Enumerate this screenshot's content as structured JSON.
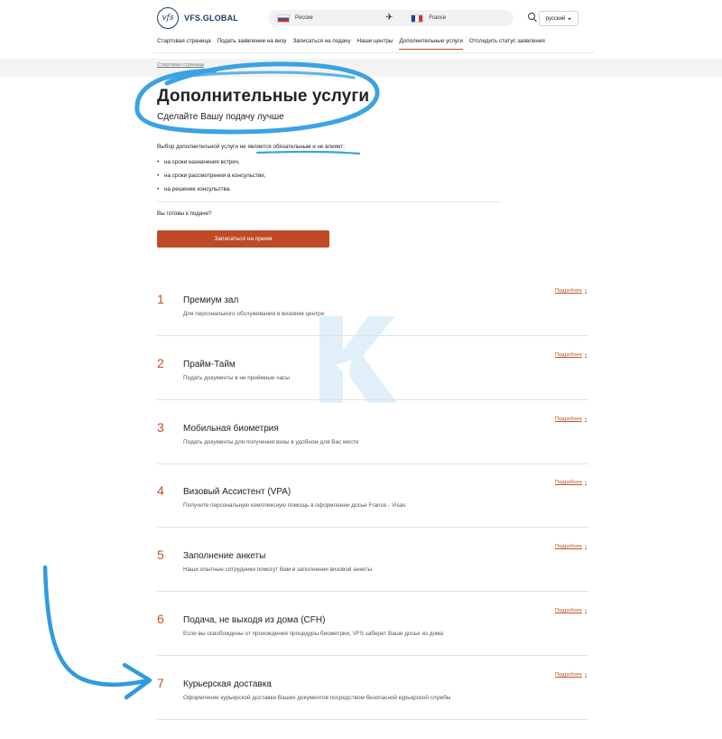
{
  "header": {
    "logo_mark": "vfs",
    "logo_text": "VFS.GLOBAL",
    "from_country": "Россия",
    "to_country": "France",
    "language": "русский"
  },
  "nav": {
    "items": [
      "Стартовая страница",
      "Подать заявление на визу",
      "Записаться на подачу",
      "Наши центры",
      "Дополнительные услуги",
      "Отследить статус заявления"
    ],
    "active_index": 4
  },
  "breadcrumb": "Стартовая страница",
  "page": {
    "title": "Дополнительные услуги",
    "subtitle": "Сделайте Вашу подачу лучше",
    "intro": "Выбор дополнительной услуги не является обязательным и не влияет:",
    "bullets": [
      "на сроки назначения встреч,",
      "на сроки рассмотрения в консульстве,",
      "на решение консульства."
    ],
    "ready_question": "Вы готовы к подаче?",
    "cta_label": "Записаться на прием"
  },
  "services": [
    {
      "num": "1",
      "title": "Премиум зал",
      "desc": "Для персонального обслуживания в визовом центре",
      "more": "Подробнее"
    },
    {
      "num": "2",
      "title": "Прайм-Тайм",
      "desc": "Подать документы в не приёмные часы",
      "more": "Подробнее"
    },
    {
      "num": "3",
      "title": "Мобильная биометрия",
      "desc": "Подать документы для получения визы в удобном для Вас месте",
      "more": "Подробнее"
    },
    {
      "num": "4",
      "title": "Визовый Ассистент (VPA)",
      "desc": "Получите персональную комплексную помощь в оформлении досье France - Visas",
      "more": "Подробнее"
    },
    {
      "num": "5",
      "title": "Заполнение анкеты",
      "desc": "Наши опытные сотрудники помогут Вам в заполнении визовой анкеты",
      "more": "Подробнее"
    },
    {
      "num": "6",
      "title": "Подача, не выходя из дома (CFH)",
      "desc": "Если вы освобождены от прохождения процедуры биометрии, VFS заберет Ваше досье из дома",
      "more": "Подробнее"
    },
    {
      "num": "7",
      "title": "Курьерская доставка",
      "desc": "Оформление курьерской доставки Ваших документов посредством безопасной курьерской службы",
      "more": "Подробнее"
    }
  ],
  "colors": {
    "accent": "#c0502a",
    "button": "#bf4b26",
    "annotation_blue": "#3aa3e3",
    "brand_navy": "#1f3a6b"
  },
  "icons": [
    "search-icon",
    "plane-icon",
    "chevron-down-icon",
    "arrow-right-icon"
  ]
}
